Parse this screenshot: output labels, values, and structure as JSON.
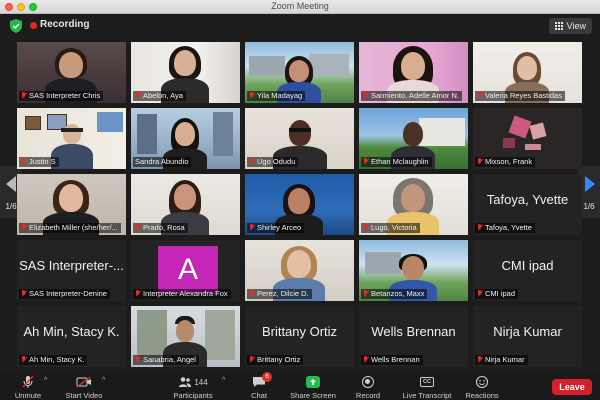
{
  "window": {
    "title": "Zoom Meeting"
  },
  "topbar": {
    "recording_label": "Recording",
    "view_label": "View"
  },
  "pagination": {
    "left_page": "1/6",
    "right_page": "1/6"
  },
  "tiles": [
    {
      "name": "SAS Interpreter Chris",
      "video": true
    },
    {
      "name": "Abelon, Aya",
      "video": true
    },
    {
      "name": "Yila Madayag",
      "video": true
    },
    {
      "name": "Sarmiento, Adelle Amor N.",
      "video": true
    },
    {
      "name": "Valeria Reyes Bastidas",
      "video": true
    },
    {
      "name": "Justin S",
      "video": true
    },
    {
      "name": "Sandra Abundio",
      "video": true,
      "active": true
    },
    {
      "name": "Ugo Odudu",
      "video": true
    },
    {
      "name": "Ethan Mclaughlin",
      "video": true
    },
    {
      "name": "Mixson, Frank",
      "video": true
    },
    {
      "name": "Elizabeth Miller (she/her/...",
      "video": true
    },
    {
      "name": "Prado, Rosa",
      "video": true
    },
    {
      "name": "Shirley Arceo",
      "video": true
    },
    {
      "name": "Lugo, Victoria",
      "video": true
    },
    {
      "name": "Tafoya, Yvette",
      "big_name": "Tafoya, Yvette",
      "video": false
    },
    {
      "name": "SAS Interpreter-Denine",
      "big_name": "SAS Interpreter-...",
      "video": false
    },
    {
      "name": "Interpreter Alexandra Fox",
      "avatar_letter": "A",
      "video": false
    },
    {
      "name": "Perez, Dilcie D.",
      "video": true
    },
    {
      "name": "Betanzos, Maxx",
      "video": true
    },
    {
      "name": "CMI ipad",
      "big_name": "CMI ipad",
      "video": false
    },
    {
      "name": "Ah Min, Stacy K.",
      "big_name": "Ah Min, Stacy K.",
      "video": false
    },
    {
      "name": "Sanabria, Angel",
      "video": true
    },
    {
      "name": "Brittany Ortiz",
      "big_name": "Brittany Ortiz",
      "video": false
    },
    {
      "name": "Wells Brennan",
      "big_name": "Wells Brennan",
      "video": false
    },
    {
      "name": "Nirja Kumar",
      "big_name": "Nirja Kumar",
      "video": false
    }
  ],
  "toolbar": {
    "unmute_label": "Unmute",
    "start_video_label": "Start Video",
    "participants_label": "Participants",
    "participants_count": "144",
    "chat_label": "Chat",
    "chat_badge": "6",
    "share_label": "Share Screen",
    "record_label": "Record",
    "live_transcript_label": "Live Transcript",
    "cc_text": "CC",
    "reactions_label": "Reactions",
    "leave_label": "Leave"
  },
  "colors": {
    "active_speaker": "#b5d64a",
    "leave": "#d3202a",
    "share": "#20c04b",
    "recording": "#e02828",
    "accent": "#2d8cff"
  }
}
